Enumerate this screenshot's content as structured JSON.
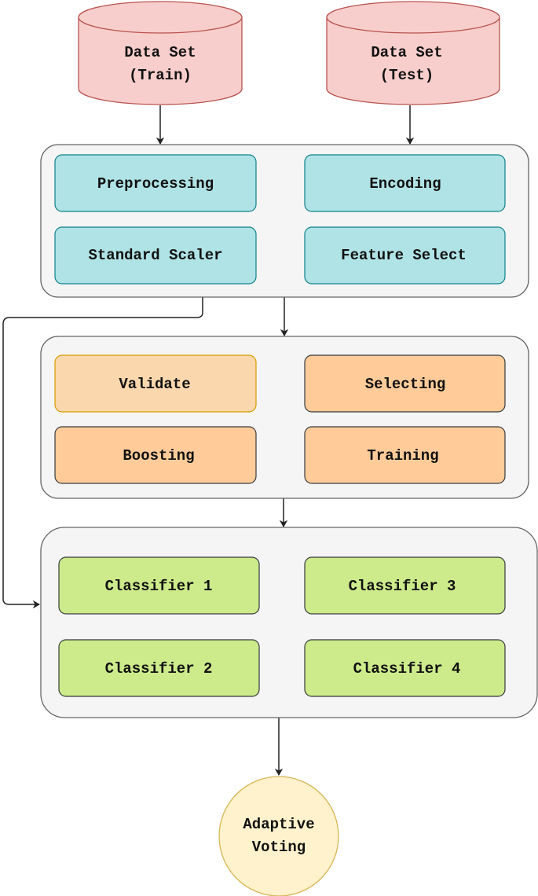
{
  "colors": {
    "dataset_fill": "#f8cecc",
    "dataset_stroke": "#b85450",
    "prep_fill": "#b0e3e6",
    "prep_stroke": "#0e8088",
    "model_fill": "#ffcc99",
    "model_stroke": "#36393d",
    "validate_fill": "#fad7ac",
    "validate_stroke": "#d79b00",
    "classifier_fill": "#cdeb8b",
    "classifier_stroke": "#36393d",
    "voting_fill": "#fff2cc",
    "voting_stroke": "#d6b656",
    "group_fill": "#f5f5f5"
  },
  "datasets": [
    {
      "line1": "Data Set",
      "line2": "(Train)"
    },
    {
      "line1": "Data Set",
      "line2": "(Test)"
    }
  ],
  "preprocessing_group": [
    "Preprocessing",
    "Encoding",
    "Standard Scaler",
    "Feature Select"
  ],
  "model_group": [
    "Validate",
    "Selecting",
    "Boosting",
    "Training"
  ],
  "classifier_group": [
    "Classifier 1",
    "Classifier 3",
    "Classifier 2",
    "Classifier 4"
  ],
  "output": {
    "line1": "Adaptive",
    "line2": "Voting"
  }
}
